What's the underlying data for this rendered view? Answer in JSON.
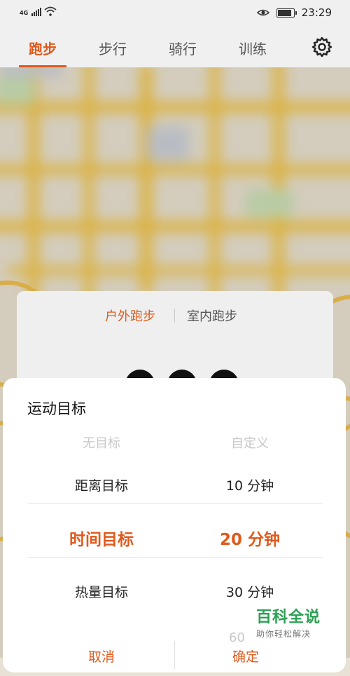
{
  "status_bar": {
    "network": "4G",
    "time": "23:29",
    "icons": [
      "signal-icon",
      "wifi-icon",
      "eye-icon",
      "battery-icon"
    ]
  },
  "top_tabs": [
    {
      "label": "跑步",
      "active": true
    },
    {
      "label": "步行",
      "active": false
    },
    {
      "label": "骑行",
      "active": false
    },
    {
      "label": "训练",
      "active": false
    }
  ],
  "run_card": {
    "modes": [
      {
        "label": "户外跑步",
        "active": true
      },
      {
        "label": "室内跑步",
        "active": false
      }
    ]
  },
  "sheet": {
    "title": "运动目标",
    "left_options": [
      "无目标",
      "距离目标",
      "时间目标",
      "热量目标"
    ],
    "right_options": [
      "自定义",
      "10 分钟",
      "20 分钟",
      "30 分钟",
      "60"
    ],
    "selected_left": "时间目标",
    "selected_right": "20 分钟",
    "cancel_label": "取消",
    "confirm_label": "确定"
  },
  "watermark": {
    "main": "百科全说",
    "sub": "助你轻松解决"
  },
  "colors": {
    "accent": "#e05a1c",
    "watermark_green": "#2aa052"
  }
}
